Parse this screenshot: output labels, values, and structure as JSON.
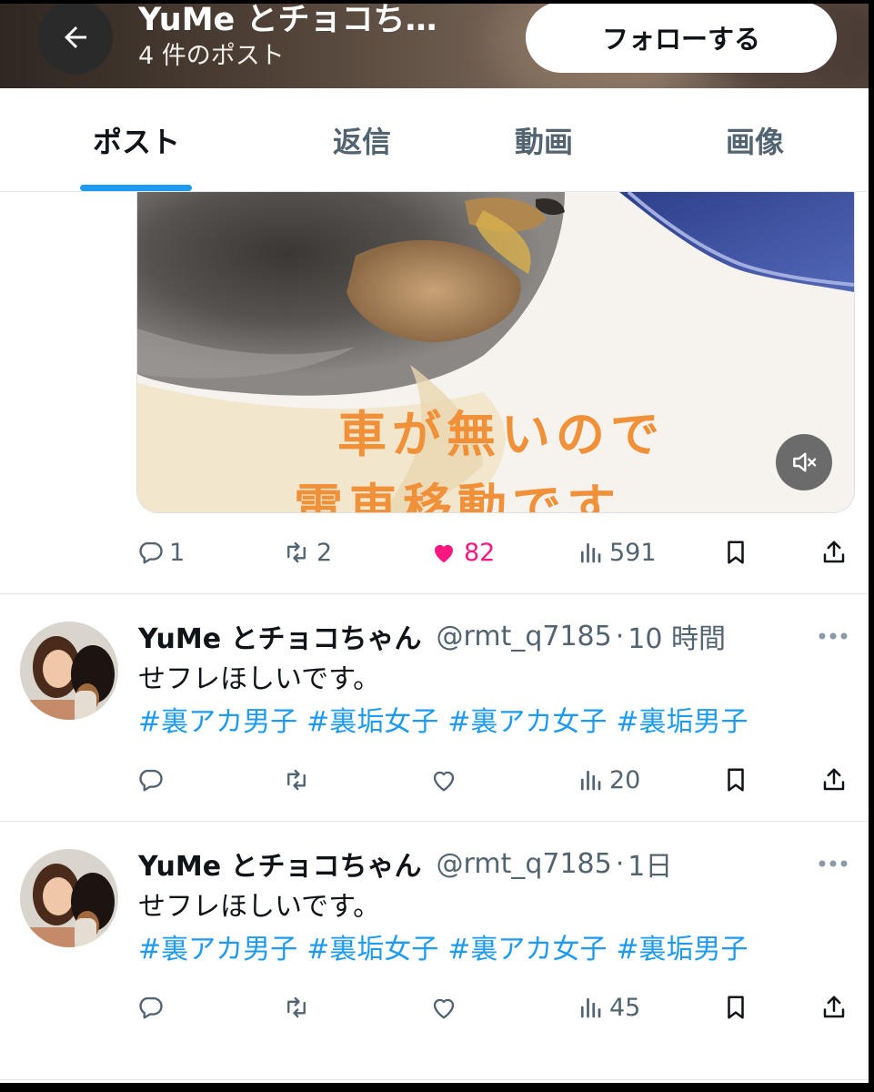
{
  "header": {
    "display_name": "YuMe とチョコち…",
    "post_count": "4 件のポスト",
    "follow_label": "フォローする"
  },
  "tabs": [
    "ポスト",
    "返信",
    "動画",
    "画像"
  ],
  "media": {
    "caption_line1": "車が無いので",
    "caption_line2": "電車移動です"
  },
  "first_post_actions": {
    "replies": "1",
    "reposts": "2",
    "likes": "82",
    "views": "591"
  },
  "posts": [
    {
      "name": "YuMe とチョコちゃん",
      "handle": "@rmt_q7185",
      "time": "10 時間",
      "text": "せフレほしいです。",
      "hashtags": [
        "#裏アカ男子",
        "#裏垢女子",
        "#裏アカ女子",
        "#裏垢男子"
      ],
      "views": "20"
    },
    {
      "name": "YuMe とチョコちゃん",
      "handle": "@rmt_q7185",
      "time": "1日",
      "text": "せフレほしいです。",
      "hashtags": [
        "#裏アカ男子",
        "#裏垢女子",
        "#裏アカ女子",
        "#裏垢男子"
      ],
      "views": "45"
    }
  ],
  "colors": {
    "accent": "#1d9bf0",
    "like": "#f91880",
    "muted_text": "#536471"
  }
}
